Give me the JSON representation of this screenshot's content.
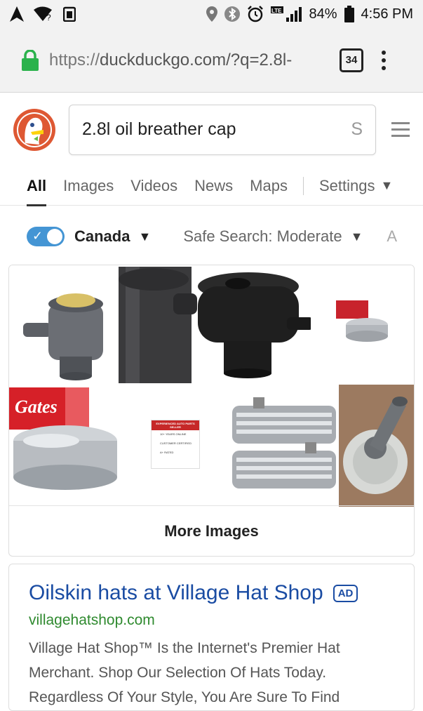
{
  "status_bar": {
    "battery": "84%",
    "time": "4:56 PM",
    "network": "LTE"
  },
  "browser": {
    "url_proto": "https://",
    "url_rest": "duckduckgo.com/?q=2.8l-",
    "tab_count": "34"
  },
  "search": {
    "query": "2.8l oil breather cap",
    "submit_label": "S"
  },
  "tabs": [
    {
      "label": "All"
    },
    {
      "label": "Images"
    },
    {
      "label": "Videos"
    },
    {
      "label": "News"
    },
    {
      "label": "Maps"
    }
  ],
  "settings_label": "Settings",
  "filters": {
    "region": "Canada",
    "safe_search": "Safe Search: Moderate",
    "time": "A"
  },
  "images": {
    "more_label": "More Images",
    "gates_label": "Gates",
    "seller_lines": [
      "EXPERIENCED AUTO PARTS SELLER",
      "10+ YEARS ONLINE",
      "CUSTOMER CERTIFIED",
      "A+ RATED"
    ]
  },
  "ad": {
    "title": "Oilskin hats at Village Hat Shop",
    "badge": "AD",
    "url": "villagehatshop.com",
    "description": "Village Hat Shop™ Is the Internet's Premier Hat Merchant. Shop Our Selection Of Hats Today. Regardless Of Your Style, You Are Sure To Find"
  },
  "colors": {
    "accent": "#4495d4",
    "link": "#1a4ca3",
    "url_green": "#2f8a2f",
    "lock_green": "#2bb24c",
    "logo_orange": "#de5833"
  }
}
